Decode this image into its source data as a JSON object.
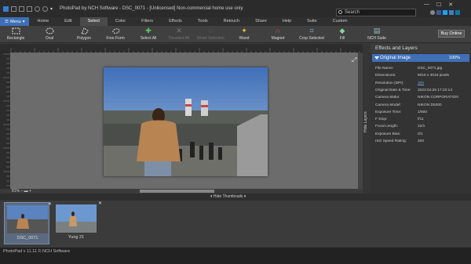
{
  "app": {
    "title": "PhotoPad by NCH Software - DSC_0071 - [Unlicensed] Non-commercial home use only",
    "search_placeholder": "Search"
  },
  "tabs": {
    "menu": "Menu",
    "items": [
      "Home",
      "Edit",
      "Select",
      "Color",
      "Filters",
      "Effects",
      "Tools",
      "Retouch",
      "Share",
      "Help",
      "Suite",
      "Custom"
    ],
    "active": "Select"
  },
  "toolbar": {
    "rectangle": "Rectangle",
    "oval": "Oval",
    "polygon": "Polygon",
    "free_form": "Free Form",
    "select_all": "Select All",
    "deselect_all": "Deselect All",
    "smart_selection": "Smart Selection",
    "wand": "Wand",
    "magnet": "Magnet",
    "crop_selected": "Crop Selected",
    "fill": "Fill",
    "nch_suite": "NCH Suite",
    "buy_online": "Buy Online"
  },
  "canvas": {
    "zoom": "81%"
  },
  "side": {
    "hide_layers": "Hide Layers"
  },
  "panel": {
    "title": "Effects and Layers",
    "original_image": "Original Image",
    "zoom": "100%",
    "properties": [
      {
        "key": "File Name:",
        "value": "DSC_0071.jpg"
      },
      {
        "key": "Dimensions:",
        "value": "6016 x 4016 pixels"
      },
      {
        "key": "Resolution (DPI):",
        "value": "300"
      },
      {
        "key": "Original Date & Time:",
        "value": "2022:04:26 17:22:14"
      },
      {
        "key": "Camera Make:",
        "value": "NIKON CORPORATION"
      },
      {
        "key": "Camera Model:",
        "value": "NIKON D5300"
      },
      {
        "key": "Exposure Time:",
        "value": "1/500"
      },
      {
        "key": "F Stop:",
        "value": "f/11"
      },
      {
        "key": "Focal Length:",
        "value": "22/1"
      },
      {
        "key": "Exposure Bias:",
        "value": "0/1"
      },
      {
        "key": "ISO Speed Rating:",
        "value": "200"
      }
    ]
  },
  "thumbbar": {
    "hide_thumbnails": "Hide Thumbnails"
  },
  "thumbnails": [
    {
      "label": "DSC_0071"
    },
    {
      "label": "Yung 21"
    }
  ],
  "status": {
    "text": "PhotoPad v 11.11 © NCH Software"
  },
  "colors": {
    "accent": "#3f6fb6",
    "link": "#6fa3e6"
  }
}
